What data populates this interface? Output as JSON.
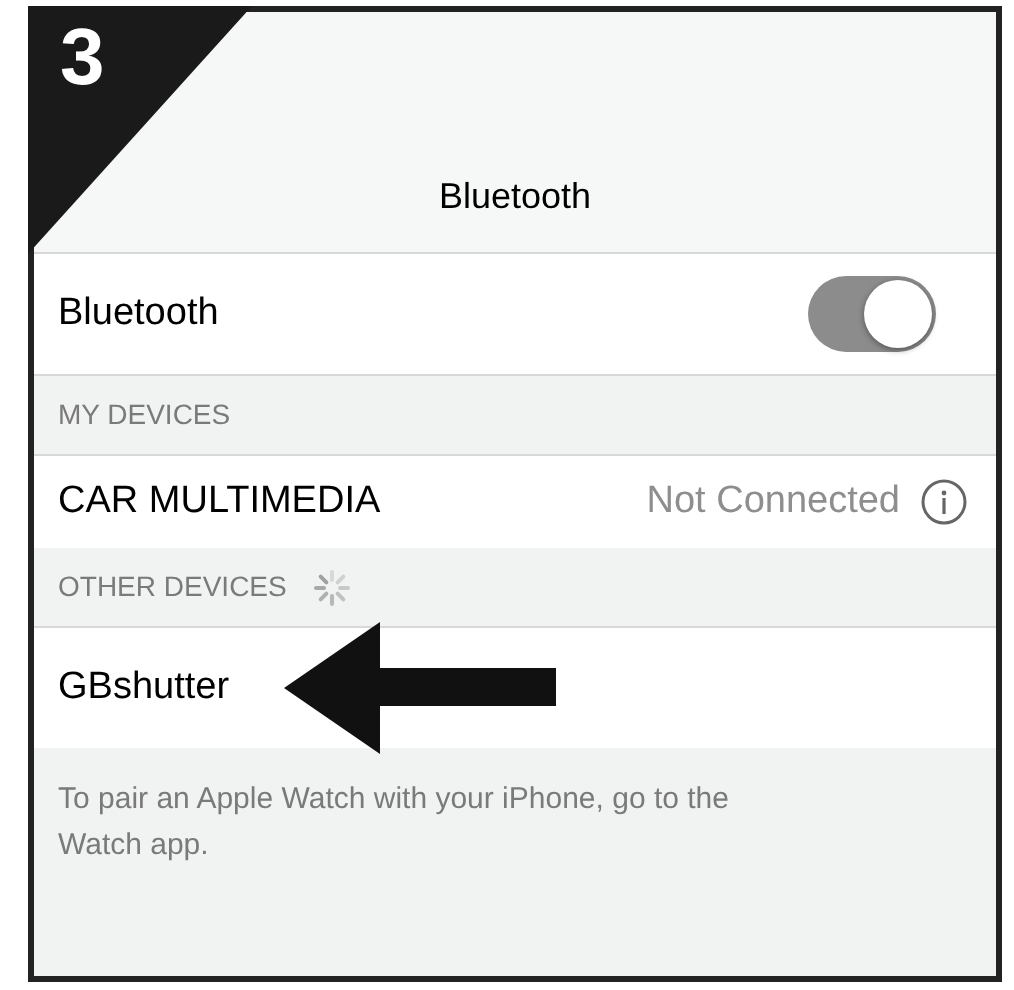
{
  "step": "3",
  "nav_title": "Bluetooth",
  "bluetooth_toggle": {
    "label": "Bluetooth",
    "on": true
  },
  "sections": [
    {
      "header": "MY DEVICES",
      "scanning": false,
      "devices": [
        {
          "name": "CAR MULTIMEDIA",
          "status": "Not Connected",
          "info": true,
          "pointed": false
        }
      ]
    },
    {
      "header": "OTHER DEVICES",
      "scanning": true,
      "devices": [
        {
          "name": "GBshutter",
          "info": false,
          "pointed": true
        }
      ]
    }
  ],
  "footer": "To pair an Apple Watch with your iPhone, go to the Watch app."
}
